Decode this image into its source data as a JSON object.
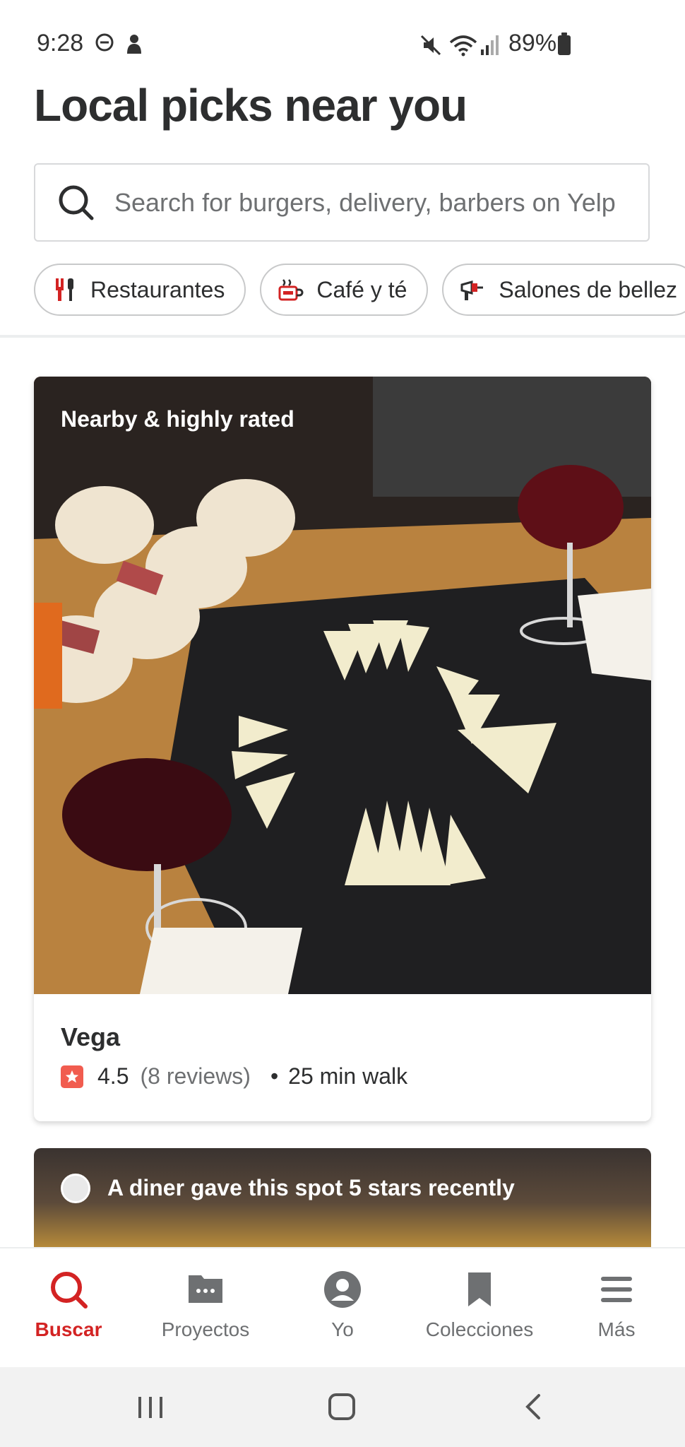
{
  "status_bar": {
    "time": "9:28",
    "battery": "89%"
  },
  "header": {
    "title": "Local picks near you"
  },
  "search": {
    "placeholder": "Search for burgers, delivery, barbers on Yelp"
  },
  "chips": [
    {
      "label": "Restaurantes",
      "icon": "restaurant-icon"
    },
    {
      "label": "Café y té",
      "icon": "coffee-icon"
    },
    {
      "label": "Salones de bellez",
      "icon": "beauty-salon-icon"
    }
  ],
  "cards": [
    {
      "label": "Nearby & highly rated",
      "name": "Vega",
      "rating": "4.5",
      "reviews": "(8 reviews)",
      "bullet": "•",
      "walk": "25 min walk"
    },
    {
      "label": "A diner gave this spot 5 stars recently"
    }
  ],
  "bottom_nav": [
    {
      "label": "Buscar",
      "icon": "search-icon",
      "active": true
    },
    {
      "label": "Proyectos",
      "icon": "projects-icon"
    },
    {
      "label": "Yo",
      "icon": "profile-icon"
    },
    {
      "label": "Colecciones",
      "icon": "bookmark-icon"
    },
    {
      "label": "Más",
      "icon": "menu-icon"
    }
  ],
  "colors": {
    "accent": "#d32323",
    "star": "#f15c4f",
    "text": "#2d2e2f",
    "muted": "#6e7072"
  }
}
